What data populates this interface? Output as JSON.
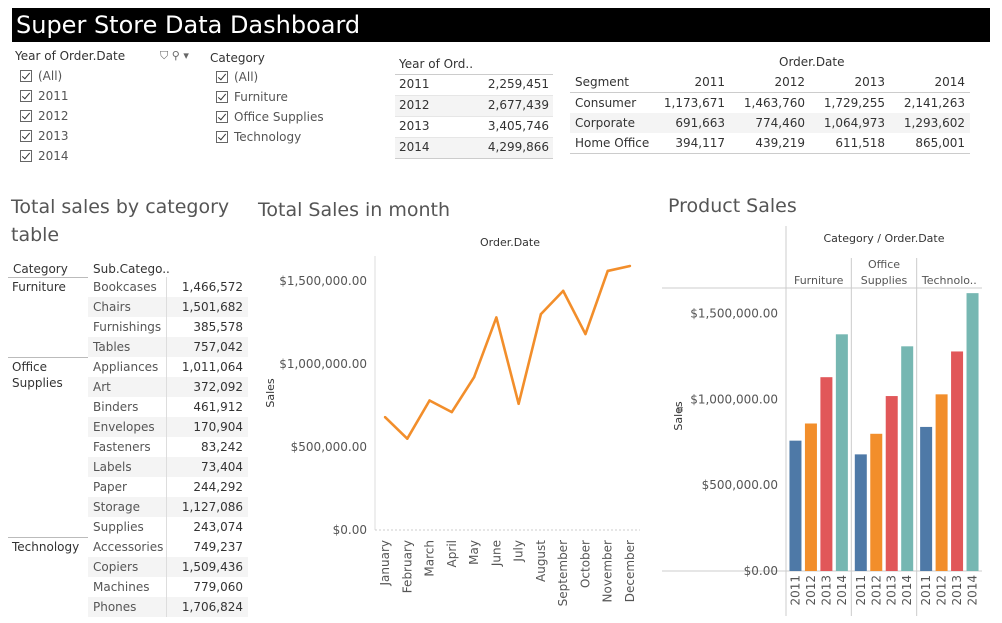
{
  "title": "Super Store Data Dashboard",
  "filters": {
    "year": {
      "title": "Year of Order.Date",
      "options": [
        "(All)",
        "2011",
        "2012",
        "2013",
        "2014"
      ]
    },
    "category": {
      "title": "Category",
      "options": [
        "(All)",
        "Furniture",
        "Office Supplies",
        "Technology"
      ]
    }
  },
  "year_table": {
    "header": "Year of Ord..",
    "rows": [
      {
        "year": "2011",
        "value": "2,259,451"
      },
      {
        "year": "2012",
        "value": "2,677,439"
      },
      {
        "year": "2013",
        "value": "3,405,746"
      },
      {
        "year": "2014",
        "value": "4,299,866"
      }
    ]
  },
  "segment_table": {
    "group_header": "Order.Date",
    "row_header": "Segment",
    "columns": [
      "2011",
      "2012",
      "2013",
      "2014"
    ],
    "rows": [
      {
        "segment": "Consumer",
        "values": [
          "1,173,671",
          "1,463,760",
          "1,729,255",
          "2,141,263"
        ]
      },
      {
        "segment": "Corporate",
        "values": [
          "691,663",
          "774,460",
          "1,064,973",
          "1,293,602"
        ]
      },
      {
        "segment": "Home Office",
        "values": [
          "394,117",
          "439,219",
          "611,518",
          "865,001"
        ]
      }
    ]
  },
  "category_table": {
    "title_line1": "Total sales by category",
    "title_line2": "table",
    "col1": "Category",
    "col2": "Sub.Catego..",
    "groups": [
      {
        "category": "Furniture",
        "items": [
          {
            "sub": "Bookcases",
            "value": "1,466,572"
          },
          {
            "sub": "Chairs",
            "value": "1,501,682"
          },
          {
            "sub": "Furnishings",
            "value": "385,578"
          },
          {
            "sub": "Tables",
            "value": "757,042"
          }
        ]
      },
      {
        "category": "Office Supplies",
        "items": [
          {
            "sub": "Appliances",
            "value": "1,011,064"
          },
          {
            "sub": "Art",
            "value": "372,092"
          },
          {
            "sub": "Binders",
            "value": "461,912"
          },
          {
            "sub": "Envelopes",
            "value": "170,904"
          },
          {
            "sub": "Fasteners",
            "value": "83,242"
          },
          {
            "sub": "Labels",
            "value": "73,404"
          },
          {
            "sub": "Paper",
            "value": "244,292"
          },
          {
            "sub": "Storage",
            "value": "1,127,086"
          },
          {
            "sub": "Supplies",
            "value": "243,074"
          }
        ]
      },
      {
        "category": "Technology",
        "items": [
          {
            "sub": "Accessories",
            "value": "749,237"
          },
          {
            "sub": "Copiers",
            "value": "1,509,436"
          },
          {
            "sub": "Machines",
            "value": "779,060"
          },
          {
            "sub": "Phones",
            "value": "1,706,824"
          }
        ]
      }
    ]
  },
  "chart_data": [
    {
      "type": "line",
      "title": "Total Sales in month",
      "header": "Order.Date",
      "ylabel": "Sales",
      "x": [
        "January",
        "February",
        "March",
        "April",
        "May",
        "June",
        "July",
        "August",
        "September",
        "October",
        "November",
        "December"
      ],
      "series": [
        {
          "values": [
            680000,
            550000,
            780000,
            710000,
            920000,
            1280000,
            760000,
            1300000,
            1440000,
            1180000,
            1560000,
            1590000
          ]
        }
      ],
      "ylim": [
        0,
        1650000
      ],
      "yticks": [
        "$0.00",
        "$500,000.00",
        "$1,000,000.00",
        "$1,500,000.00"
      ],
      "color": "#f28e2b",
      "grid": false
    },
    {
      "type": "bar",
      "title": "Product Sales",
      "header": "Category / Order.Date",
      "ylabel": "Sales",
      "groups": [
        "Furniture",
        "Office Supplies",
        "Technolo.."
      ],
      "categories": [
        "2011",
        "2012",
        "2013",
        "2014"
      ],
      "values": [
        [
          760000,
          860000,
          1130000,
          1380000
        ],
        [
          680000,
          800000,
          1020000,
          1310000
        ],
        [
          840000,
          1030000,
          1280000,
          1620000
        ]
      ],
      "ylim": [
        0,
        1650000
      ],
      "yticks": [
        "$0.00",
        "$500,000.00",
        "$1,000,000.00",
        "$1,500,000.00"
      ],
      "colors": [
        "#4e79a7",
        "#f28e2b",
        "#e15759",
        "#76b7b2"
      ]
    }
  ]
}
